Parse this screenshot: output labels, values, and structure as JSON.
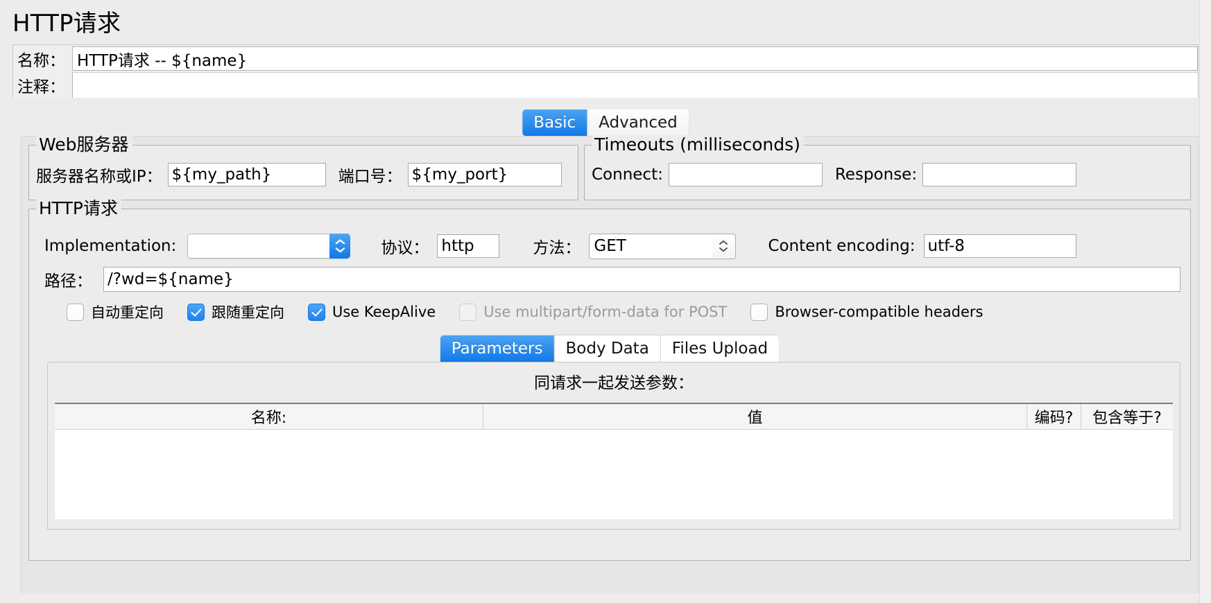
{
  "page": {
    "title": "HTTP请求"
  },
  "meta": {
    "name_label": "名称：",
    "name_value": "HTTP请求 -- ${name}",
    "comment_label": "注释：",
    "comment_value": ""
  },
  "top_tabs": [
    {
      "label": "Basic",
      "active": true
    },
    {
      "label": "Advanced",
      "active": false
    }
  ],
  "web_server": {
    "group_title": "Web服务器",
    "server_label": "服务器名称或IP：",
    "server_value": "${my_path}",
    "port_label": "端口号：",
    "port_value": "${my_port}"
  },
  "timeouts": {
    "group_title": "Timeouts (milliseconds)",
    "connect_label": "Connect:",
    "connect_value": "",
    "response_label": "Response:",
    "response_value": ""
  },
  "http_request": {
    "group_title": "HTTP请求",
    "implementation_label": "Implementation:",
    "implementation_value": "",
    "protocol_label": "协议：",
    "protocol_value": "http",
    "method_label": "方法：",
    "method_value": "GET",
    "content_encoding_label": "Content encoding:",
    "content_encoding_value": "utf-8",
    "path_label": "路径：",
    "path_value": "/?wd=${name}",
    "checkboxes": [
      {
        "label": "自动重定向",
        "checked": false,
        "disabled": false
      },
      {
        "label": "跟随重定向",
        "checked": true,
        "disabled": false
      },
      {
        "label": "Use KeepAlive",
        "checked": true,
        "disabled": false
      },
      {
        "label": "Use multipart/form-data for POST",
        "checked": false,
        "disabled": true
      },
      {
        "label": "Browser-compatible headers",
        "checked": false,
        "disabled": false
      }
    ]
  },
  "inner_tabs": [
    {
      "label": "Parameters",
      "active": true
    },
    {
      "label": "Body Data",
      "active": false
    },
    {
      "label": "Files Upload",
      "active": false
    }
  ],
  "parameters": {
    "caption": "同请求一起发送参数：",
    "columns": [
      "名称:",
      "值",
      "编码?",
      "包含等于?"
    ],
    "rows": []
  },
  "colors": {
    "accent_blue": "#1179e8",
    "window_bg": "#ececec",
    "panel_bg": "#e6e6e6",
    "disabled_text": "#9a9a9a"
  }
}
